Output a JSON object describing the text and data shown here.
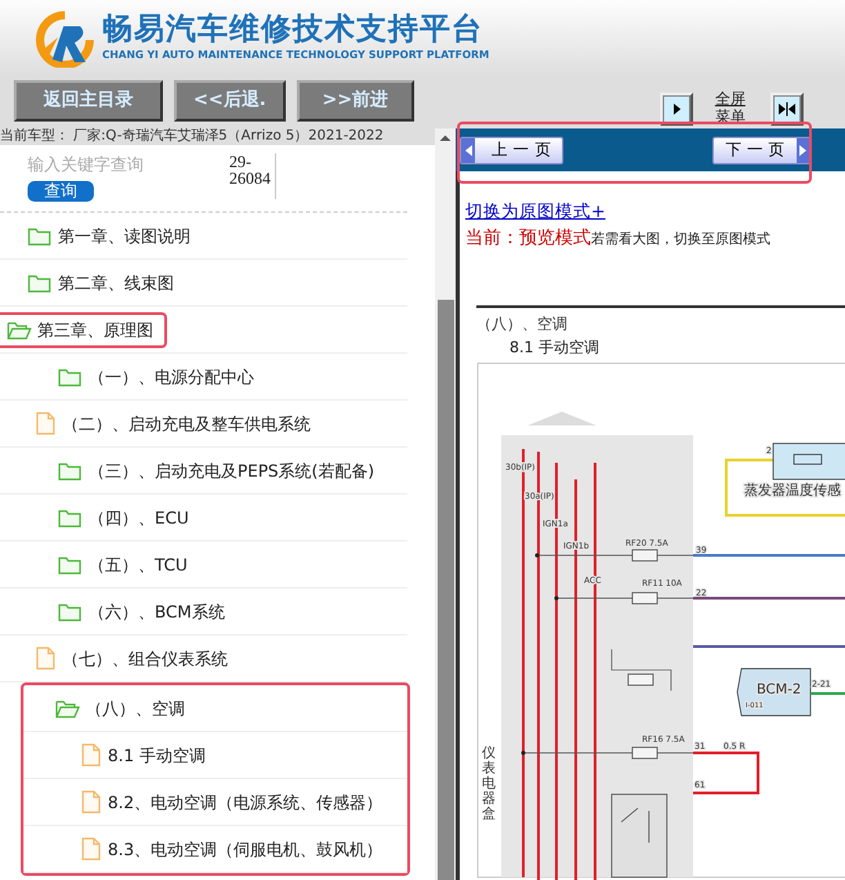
{
  "header": {
    "title": "畅易汽车维修技术支持平台",
    "subtitle": "CHANG YI AUTO MAINTENANCE TECHNOLOGY SUPPORT PLATFORM"
  },
  "toolbar": {
    "buttons": [
      "返回主目录",
      "<<后退.",
      ">>前进"
    ],
    "fullscreen_label": "全屏菜单"
  },
  "vehicle": "当前车型： 厂家:Q-奇瑞汽车艾瑞泽5（Arrizo 5）2021-2022",
  "search": {
    "placeholder": "输入关键字查询",
    "button": "查询",
    "count": "29-26084"
  },
  "tree": [
    {
      "label": "第一章、读图说明",
      "kind": "folder",
      "expanded": false,
      "highlighted": false
    },
    {
      "label": "第二章、线束图",
      "kind": "folder",
      "expanded": false,
      "highlighted": false
    },
    {
      "label": "第三章、原理图",
      "kind": "folder",
      "expanded": true,
      "highlighted": true,
      "children": [
        {
          "label": "（一）、电源分配中心",
          "kind": "folder",
          "expanded": false,
          "highlighted": false
        },
        {
          "label": "（二）、启动充电及整车供电系统",
          "kind": "file",
          "highlighted": false
        },
        {
          "label": "（三）、启动充电及PEPS系统(若配备)",
          "kind": "folder",
          "expanded": false,
          "highlighted": false
        },
        {
          "label": "（四）、ECU",
          "kind": "folder",
          "expanded": false,
          "highlighted": false
        },
        {
          "label": "（五）、TCU",
          "kind": "folder",
          "expanded": false,
          "highlighted": false
        },
        {
          "label": "（六）、BCM系统",
          "kind": "folder",
          "expanded": false,
          "highlighted": false
        },
        {
          "label": "（七）、组合仪表系统",
          "kind": "file",
          "highlighted": false
        },
        {
          "label": "（八）、空调",
          "kind": "folder",
          "expanded": true,
          "highlighted": true,
          "children": [
            {
              "label": "8.1 手动空调",
              "kind": "file",
              "highlighted": true
            },
            {
              "label": "8.2、电动空调（电源系统、传感器）",
              "kind": "file",
              "highlighted": true
            },
            {
              "label": "8.3、电动空调（伺服电机、鼓风机）",
              "kind": "file",
              "highlighted": true
            }
          ]
        }
      ]
    }
  ],
  "pager": {
    "highlighted": true,
    "prev": "上 一 页",
    "next": "下 一 页"
  },
  "mode": {
    "link": "切换为原图模式+",
    "status": "当前：",
    "mode": "预览模式",
    "hint": "若需看大图，切换至原图模式"
  },
  "document": {
    "heading": "（八）、空调",
    "subheading": "8.1 手动空调",
    "diagram_labels": [
      "30b(IP)",
      "30a(IP)",
      "IGN1a",
      "IGN1b",
      "ACC",
      "RF20 7.5A",
      "39",
      "RF11 10A",
      "22",
      "RF16 7.5A",
      "31",
      "0.5 R",
      "61",
      "2",
      "蒸发器温度传感",
      "BCM-2",
      "I-011",
      "2-21",
      "仪表电器盒"
    ]
  }
}
